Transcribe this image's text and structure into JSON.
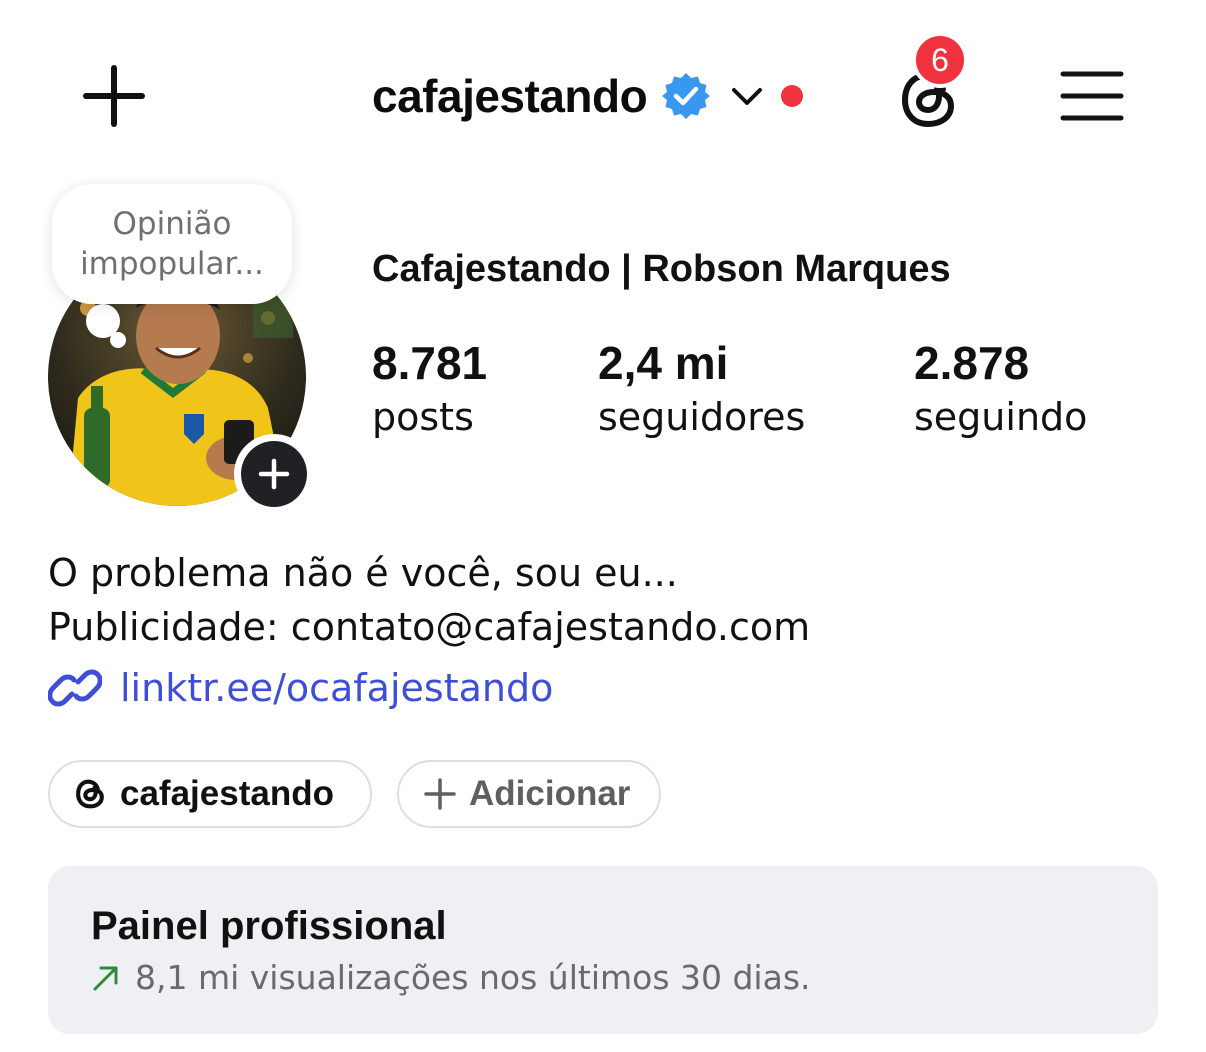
{
  "header": {
    "username": "cafajestando",
    "notification_count": "6",
    "icons": {
      "new_post": "plus-icon",
      "verified": "verified-badge-icon",
      "account_switch": "chevron-down-icon",
      "threads": "threads-icon",
      "menu": "hamburger-menu-icon"
    }
  },
  "note": {
    "line1": "Opinião",
    "line2": "impopular..."
  },
  "profile": {
    "full_name": "Cafajestando | Robson Marques",
    "stats": [
      {
        "value": "8.781",
        "label": "posts"
      },
      {
        "value": "2,4 mi",
        "label": "seguidores"
      },
      {
        "value": "2.878",
        "label": "seguindo"
      }
    ]
  },
  "bio": {
    "line1": "O problema não é você, sou eu...",
    "line2": "Publicidade: contato@cafajestando.com",
    "link": "linktr.ee/ocafajestando"
  },
  "chips": {
    "threads_label": "cafajestando",
    "add_label": "Adicionar"
  },
  "dashboard": {
    "title": "Painel profissional",
    "subtitle": "8,1 mi visualizações nos últimos 30 dias."
  },
  "colors": {
    "accent_blue": "#3f4ed6",
    "verified_blue": "#3897f0",
    "notification_red": "#f0323f",
    "trend_green": "#2e8b3a",
    "dashboard_bg": "#eef0f3"
  }
}
